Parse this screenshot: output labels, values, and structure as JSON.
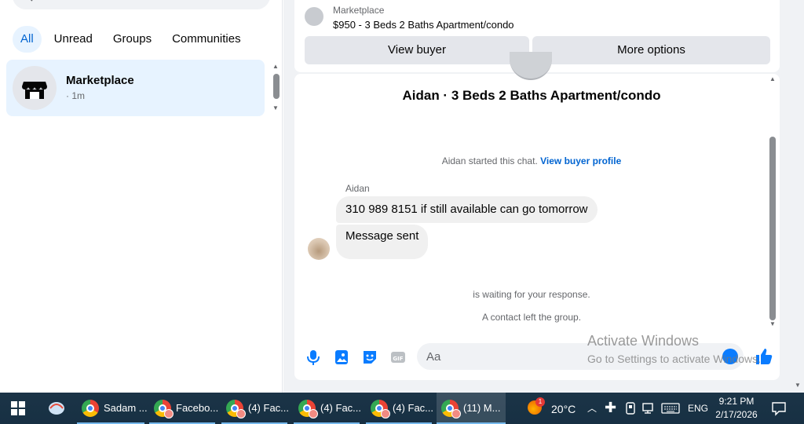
{
  "left": {
    "filters": [
      "All",
      "Unread",
      "Groups",
      "Communities"
    ],
    "conversation": {
      "title": "Marketplace",
      "subtitle": "· 1m"
    }
  },
  "card": {
    "label": "Marketplace",
    "listing": "$950 - 3 Beds 2 Baths Apartment/condo",
    "view_buyer": "View buyer",
    "more_options": "More options"
  },
  "chat": {
    "title": "Aidan · 3 Beds 2 Baths Apartment/condo",
    "started_text": "Aidan started this chat.",
    "started_link": "View buyer profile",
    "sender": "Aidan",
    "messages": [
      "310 989 8151 if still available can go tomorrow",
      "Message sent"
    ],
    "waiting": "is waiting for your response.",
    "left_group": "A contact left the group."
  },
  "composer": {
    "placeholder": "Aa"
  },
  "watermark": {
    "line1": "Activate Windows",
    "line2": "Go to Settings to activate Windows."
  },
  "taskbar": {
    "apps": [
      {
        "label": "Sadam ...",
        "badge": "C"
      },
      {
        "label": "Facebo..."
      },
      {
        "label": "(4) Fac..."
      },
      {
        "label": "(4) Fac..."
      },
      {
        "label": "(4) Fac..."
      },
      {
        "label": "(11) M..."
      }
    ],
    "weather": "20°C",
    "weather_badge": "1",
    "language": "ENG",
    "time": "9:21 PM",
    "date": "2/17/2026"
  },
  "colors": {
    "accent": "#0064d1",
    "chip_active_bg": "#e7f3ff",
    "bubble": "#f0f0f0",
    "taskbar": "#1b3447"
  }
}
